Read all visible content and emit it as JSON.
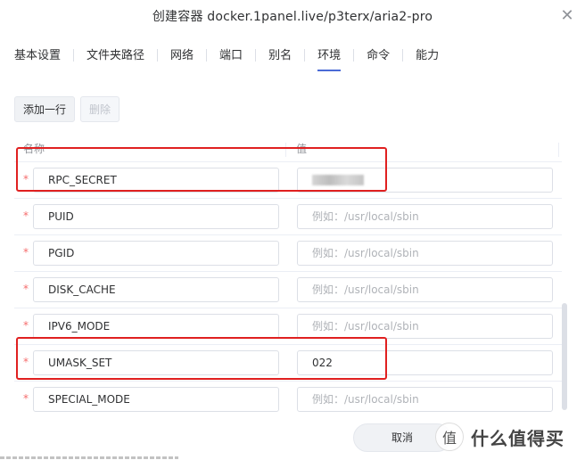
{
  "dialog": {
    "title": "创建容器 docker.1panel.live/p3terx/aria2-pro",
    "close_glyph": "✕"
  },
  "tabs": [
    {
      "label": "基本设置",
      "active": false
    },
    {
      "label": "文件夹路径",
      "active": false
    },
    {
      "label": "网络",
      "active": false
    },
    {
      "label": "端口",
      "active": false
    },
    {
      "label": "别名",
      "active": false
    },
    {
      "label": "环境",
      "active": true
    },
    {
      "label": "命令",
      "active": false
    },
    {
      "label": "能力",
      "active": false
    }
  ],
  "toolbar": {
    "add_label": "添加一行",
    "delete_label": "删除"
  },
  "table": {
    "headers": {
      "name": "名称",
      "value": "值"
    },
    "required_mark": "*",
    "rows": [
      {
        "name": "RPC_SECRET",
        "value": "",
        "placeholder": "",
        "blurred": true,
        "highlighted": true
      },
      {
        "name": "PUID",
        "value": "",
        "placeholder": "例如：/usr/local/sbin",
        "blurred": false,
        "highlighted": false
      },
      {
        "name": "PGID",
        "value": "",
        "placeholder": "例如：/usr/local/sbin",
        "blurred": false,
        "highlighted": false
      },
      {
        "name": "DISK_CACHE",
        "value": "",
        "placeholder": "例如：/usr/local/sbin",
        "blurred": false,
        "highlighted": false
      },
      {
        "name": "IPV6_MODE",
        "value": "",
        "placeholder": "例如：/usr/local/sbin",
        "blurred": false,
        "highlighted": false
      },
      {
        "name": "UMASK_SET",
        "value": "022",
        "placeholder": "",
        "blurred": false,
        "highlighted": true
      },
      {
        "name": "SPECIAL_MODE",
        "value": "",
        "placeholder": "例如：/usr/local/sbin",
        "blurred": false,
        "highlighted": false
      }
    ]
  },
  "footer": {
    "cancel_label": "取消"
  },
  "watermark": {
    "logo_glyph": "值",
    "text": "什么值得买"
  },
  "colors": {
    "accent": "#4b6bd6",
    "highlight": "#e02020",
    "required": "#f56c6c",
    "placeholder": "#b0b3b8"
  }
}
